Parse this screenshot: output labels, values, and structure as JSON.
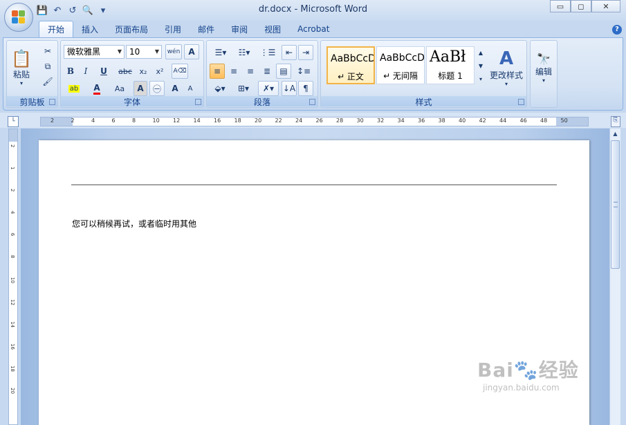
{
  "window": {
    "title": "dr.docx - Microsoft Word",
    "controls": {
      "minimize": "▭",
      "restore": "◻",
      "close": "✕"
    }
  },
  "qat": {
    "save": "💾",
    "undo": "↶",
    "redo": "↺",
    "preview": "🔍",
    "more": "▾"
  },
  "tabs": [
    {
      "label": "开始",
      "active": true
    },
    {
      "label": "插入"
    },
    {
      "label": "页面布局"
    },
    {
      "label": "引用"
    },
    {
      "label": "邮件"
    },
    {
      "label": "审阅"
    },
    {
      "label": "视图"
    },
    {
      "label": "Acrobat"
    }
  ],
  "help": "?",
  "clipboard": {
    "label": "剪贴板",
    "paste": "粘贴"
  },
  "font": {
    "label": "字体",
    "name": "微软雅黑",
    "size": "10",
    "bold": "B",
    "italic": "I",
    "underline": "U",
    "strike": "abc",
    "subscript": "x₂",
    "superscript": "x²",
    "case": "Aa",
    "grow": "A",
    "shrink": "A",
    "phonetic": "wén"
  },
  "paragraph": {
    "label": "段落"
  },
  "styles": {
    "label": "样式",
    "items": [
      {
        "sample": "AaBbCcD",
        "name": "↵ 正文"
      },
      {
        "sample": "AaBbCcD",
        "name": "↵ 无间隔"
      },
      {
        "sample": "AaBł",
        "name": "标题 1"
      }
    ],
    "change": "更改样式"
  },
  "editing": {
    "label": "编辑"
  },
  "ruler": {
    "ticks": [
      "2",
      "2",
      "4",
      "6",
      "8",
      "10",
      "12",
      "14",
      "16",
      "18",
      "20",
      "22",
      "24",
      "26",
      "28",
      "30",
      "32",
      "34",
      "36",
      "38",
      "40",
      "42",
      "44",
      "46",
      "48",
      "50"
    ],
    "vticks": [
      "2",
      "1",
      "2",
      "4",
      "6",
      "8",
      "10",
      "12",
      "14",
      "16",
      "18",
      "20"
    ]
  },
  "document": {
    "body": "您可以稍候再试，或者临时用其他"
  },
  "watermark": {
    "logo": "Bai🐾经验",
    "url": "jingyan.baidu.com"
  }
}
